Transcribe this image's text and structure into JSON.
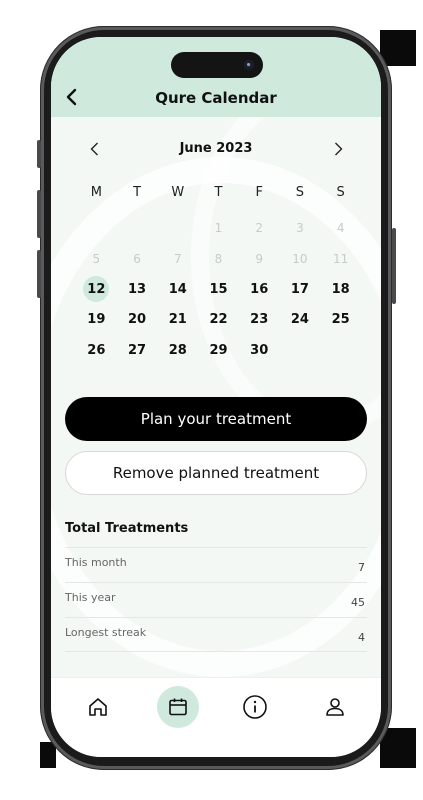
{
  "header": {
    "title": "Qure Calendar"
  },
  "calendar": {
    "month_label": "June 2023",
    "weekdays": [
      "M",
      "T",
      "W",
      "T",
      "F",
      "S",
      "S"
    ],
    "days": [
      {
        "label": "",
        "muted": false
      },
      {
        "label": "",
        "muted": false
      },
      {
        "label": "",
        "muted": false
      },
      {
        "label": "1",
        "muted": true
      },
      {
        "label": "2",
        "muted": true
      },
      {
        "label": "3",
        "muted": true
      },
      {
        "label": "4",
        "muted": true
      },
      {
        "label": "5",
        "muted": true
      },
      {
        "label": "6",
        "muted": true
      },
      {
        "label": "7",
        "muted": true
      },
      {
        "label": "8",
        "muted": true
      },
      {
        "label": "9",
        "muted": true
      },
      {
        "label": "10",
        "muted": true
      },
      {
        "label": "11",
        "muted": true
      },
      {
        "label": "12",
        "muted": false,
        "selected": true
      },
      {
        "label": "13",
        "muted": false
      },
      {
        "label": "14",
        "muted": false
      },
      {
        "label": "15",
        "muted": false
      },
      {
        "label": "16",
        "muted": false
      },
      {
        "label": "17",
        "muted": false
      },
      {
        "label": "18",
        "muted": false
      },
      {
        "label": "19",
        "muted": false
      },
      {
        "label": "20",
        "muted": false
      },
      {
        "label": "21",
        "muted": false
      },
      {
        "label": "22",
        "muted": false
      },
      {
        "label": "23",
        "muted": false
      },
      {
        "label": "24",
        "muted": false
      },
      {
        "label": "25",
        "muted": false
      },
      {
        "label": "26",
        "muted": false
      },
      {
        "label": "27",
        "muted": false
      },
      {
        "label": "28",
        "muted": false
      },
      {
        "label": "29",
        "muted": false
      },
      {
        "label": "30",
        "muted": false
      }
    ]
  },
  "actions": {
    "plan_label": "Plan your treatment",
    "remove_label": "Remove planned treatment"
  },
  "totals": {
    "title": "Total Treatments",
    "rows": [
      {
        "label": "This month",
        "value": "7"
      },
      {
        "label": "This year",
        "value": "45"
      },
      {
        "label": "Longest streak",
        "value": "4"
      }
    ]
  },
  "tabbar": {
    "items": [
      {
        "icon": "home-icon",
        "active": false
      },
      {
        "icon": "calendar-icon",
        "active": true
      },
      {
        "icon": "info-icon",
        "active": false
      },
      {
        "icon": "profile-icon",
        "active": false
      }
    ]
  },
  "colors": {
    "accent": "#cfeadd",
    "primary_button": "#000000",
    "background": "#f3f8f5"
  }
}
